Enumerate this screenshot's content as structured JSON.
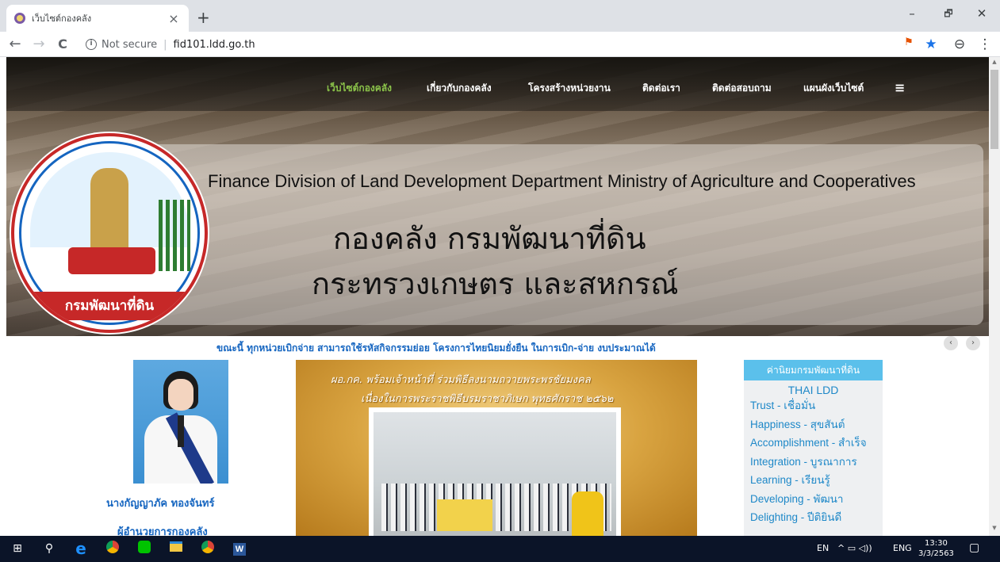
{
  "browser": {
    "tab_title": "เว็บไซต์กองคลัง",
    "tab_close": "×",
    "new_tab": "+",
    "win_minimize": "–",
    "win_restore": "🗗",
    "win_close": "✕",
    "back": "←",
    "forward": "→",
    "reload": "C",
    "security_icon_glyph": "i",
    "security_label": "Not secure",
    "separator": "|",
    "url": "fid101.ldd.go.th",
    "extension_icon": "puzzle-icon",
    "bookmark_icon_glyph": "★",
    "account_icon_glyph": "⊖",
    "menu_glyph": "⋮"
  },
  "nav": {
    "items": [
      "เว็บไซต์กองคลัง",
      "เกี่ยวกับกองคลัง",
      "โครงสร้างหน่วยงาน",
      "ติดต่อเรา",
      "ติดต่อสอบถาม",
      "แผนผังเว็บไซต์"
    ],
    "hamburger": "≡"
  },
  "banner": {
    "en_title": "Finance Division of Land Development Department Ministry of Agriculture and Cooperatives",
    "th_title_line1": "กองคลัง กรมพัฒนาที่ดิน",
    "th_title_line2": "กระทรวงเกษตร และสหกรณ์",
    "logo_text": "กรมพัฒนาที่ดิน"
  },
  "carousel": {
    "prev": "‹",
    "next": "›"
  },
  "announcement": "ขณะนี้ ทุกหน่วยเบิกจ่าย สามารถใช้รหัสกิจกรรมย่อย โครงการไทยนิยมยั่งยืน ในการเบิก-จ่าย งบประมาณได้",
  "director": {
    "name": "นางกัญญาภัค ทองจันทร์",
    "title": "ผู้อำนวยการกองคลัง"
  },
  "news": {
    "caption_line1": "ผอ.กค. พร้อมเจ้าหน้าที่ ร่วมพิธีลงนามถวายพระพรชัยมงคล",
    "caption_line2": "เนื่องในการพระราชพิธีบรมราชาภิเษก พุทธศักราช ๒๕๖๒"
  },
  "values": {
    "heading": "ค่านิยมกรมพัฒนาที่ดิน",
    "subheading": "THAI LDD",
    "items": [
      "Trust - เชื่อมั่น",
      "Happiness - สุขสันต์",
      "Accomplishment - สำเร็จ",
      "Integration - บูรณาการ",
      "Learning - เรียนรู้",
      "Developing - พัฒนา",
      "Delighting - ปีติยินดี"
    ]
  },
  "taskbar": {
    "start_glyph": "⊞",
    "search_glyph": "⚲",
    "apps": [
      "edge-icon",
      "chrome-icon",
      "line-icon",
      "file-explorer-icon",
      "chrome-icon",
      "word-icon"
    ],
    "lang_short": "EN",
    "tray_glyphs": "^ ▭ ◁))",
    "lang": "ENG",
    "time": "13:30",
    "date": "3/3/2563",
    "notification_glyph": "▢"
  },
  "colors": {
    "nav_active": "#8bc34a",
    "link_blue": "#1565c0",
    "values_header": "#5bc0eb",
    "values_text": "#1e88c8",
    "taskbar": "#0b1428"
  }
}
